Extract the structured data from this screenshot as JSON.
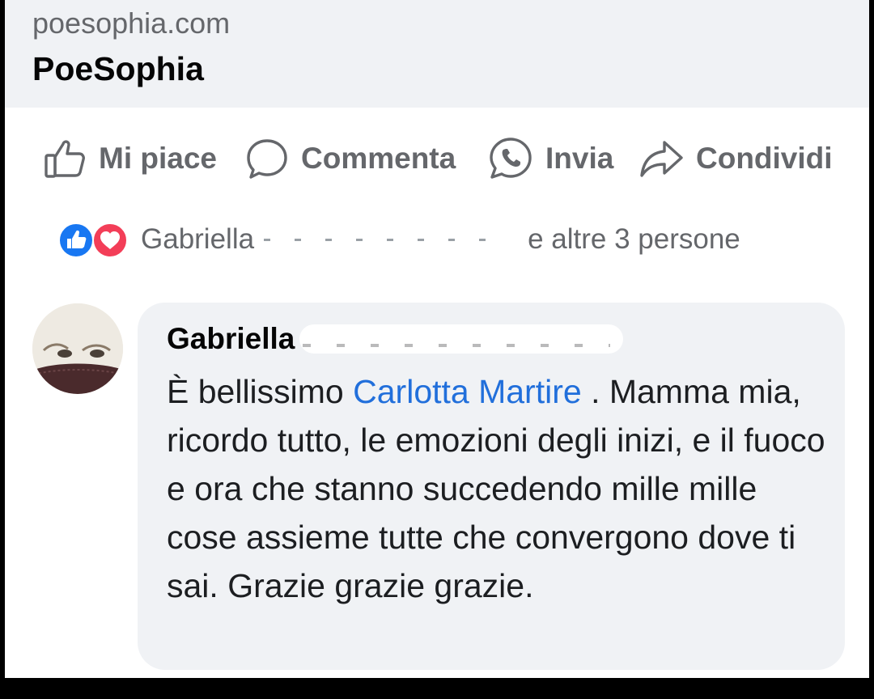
{
  "link_preview": {
    "domain": "poesophia.com",
    "page_name": "PoeSophia"
  },
  "actions": [
    {
      "label": "Mi piace",
      "icon": "thumbs-up-icon"
    },
    {
      "label": "Commenta",
      "icon": "comment-bubble-icon"
    },
    {
      "label": "Invia",
      "icon": "whatsapp-icon"
    },
    {
      "label": "Condividi",
      "icon": "share-arrow-icon"
    }
  ],
  "reactions": {
    "icons": [
      "like-reaction-icon",
      "love-reaction-icon"
    ],
    "name": "Gabriella",
    "others": "e altre 3 persone"
  },
  "comment": {
    "author": "Gabriella",
    "text_before": "È bellissimo",
    "mention": "Carlotta Martire",
    "text_after": ". Mamma mia, ricordo tutto, le emozioni degli inizi, e il fuoco e ora che stanno succedendo mille mille cose assieme tutte che convergono dove ti sai. Grazie grazie grazie."
  },
  "colors": {
    "preview_background": "#f0f2f5",
    "secondary_text": "#65676b",
    "mention_blue": "#216fdb",
    "like_blue": "#1877f2",
    "love_red": "#f33e58"
  }
}
